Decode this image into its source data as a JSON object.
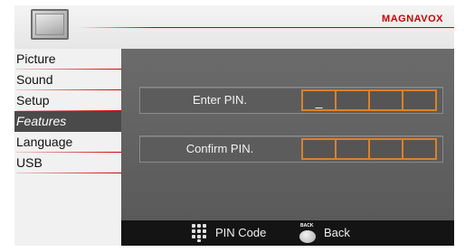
{
  "header": {
    "brand": "MAGNAVOX",
    "tv_icon": "tv-icon",
    "accent_color": "#cc0000"
  },
  "sidebar": {
    "items": [
      {
        "label": "Picture"
      },
      {
        "label": "Sound"
      },
      {
        "label": "Setup"
      },
      {
        "label": "Features",
        "active": true
      },
      {
        "label": "Language"
      },
      {
        "label": "USB"
      }
    ]
  },
  "main": {
    "enter_pin": {
      "label": "Enter PIN.",
      "boxes": [
        "_",
        "",
        "",
        ""
      ]
    },
    "confirm_pin": {
      "label": "Confirm PIN.",
      "boxes": [
        "",
        "",
        "",
        ""
      ]
    },
    "box_border_color": "#d9822b"
  },
  "footer": {
    "pin_code_icon": "keypad-icon",
    "pin_code_label": "PIN Code",
    "back_tag": "BACK",
    "back_label": "Back"
  }
}
